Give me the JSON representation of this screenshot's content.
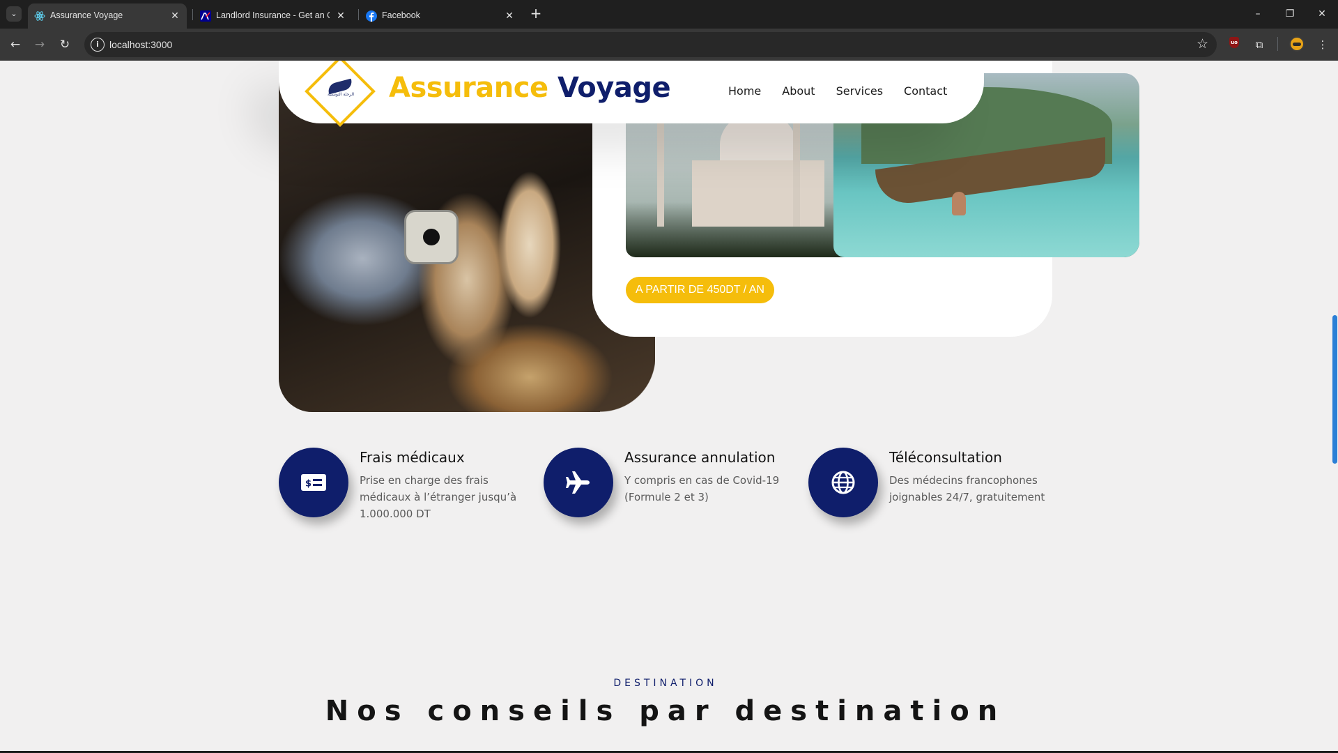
{
  "browser": {
    "tabs": [
      {
        "title": "Assurance Voyage",
        "active": true,
        "icon": "react-icon"
      },
      {
        "title": "Landlord Insurance - Get an On",
        "active": false,
        "icon": "axa-icon"
      },
      {
        "title": "Facebook",
        "active": false,
        "icon": "facebook-icon"
      }
    ],
    "url": "localhost:3000"
  },
  "header": {
    "logo_word1": "Assurance",
    "logo_word2": "Voyage",
    "logo_arabic": "الرحلة التونسية",
    "nav": [
      "Home",
      "About",
      "Services",
      "Contact"
    ]
  },
  "hero": {
    "price_label": "A PARTIR DE 450DT / AN"
  },
  "features": [
    {
      "title": "Frais médicaux",
      "description": "Prise en charge des frais médicaux à l’étranger jusqu’à 1.000.000 DT",
      "icon": "money-bill-icon"
    },
    {
      "title": "Assurance annulation",
      "description": "Y compris en cas de Covid-19 (Formule 2 et 3)",
      "icon": "plane-icon"
    },
    {
      "title": "Téléconsultation",
      "description": "Des médecins francophones joignables 24/7, gratuitement",
      "icon": "globe-icon"
    }
  ],
  "destination": {
    "kicker": "DESTINATION",
    "title": "Nos conseils par destination"
  },
  "colors": {
    "brand_navy": "#0f1e6b",
    "brand_yellow": "#f5bd0b",
    "page_bg": "#f1f0f0"
  }
}
